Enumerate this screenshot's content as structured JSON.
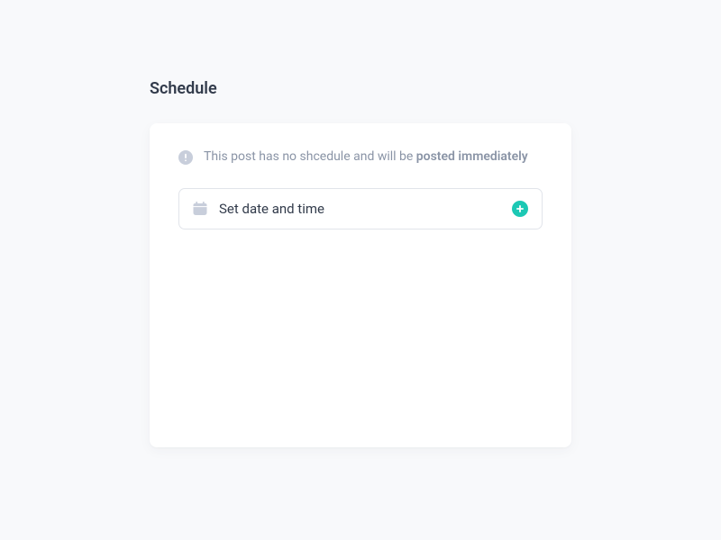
{
  "title": "Schedule",
  "info": {
    "prefix": "This post has no shcedule and will be ",
    "bold": "posted immediately"
  },
  "button": {
    "label": "Set date and time"
  },
  "colors": {
    "accent": "#1cc8b4",
    "muted": "#c8cedb",
    "text": "#323b4b",
    "subtext": "#8a94a6"
  }
}
